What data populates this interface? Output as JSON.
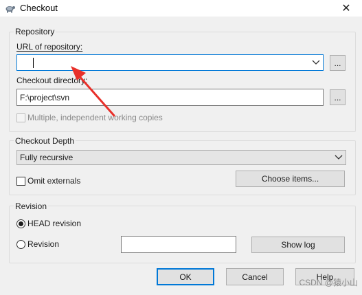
{
  "window": {
    "title": "Checkout",
    "close_glyph": "✕"
  },
  "repository": {
    "group_title": "Repository",
    "url_label": "URL of repository:",
    "url_value": "",
    "browse_label": "...",
    "checkout_dir_label": "Checkout directory:",
    "checkout_dir_value": "F:\\project\\svn",
    "checkout_browse_label": "...",
    "multiple_copies_label": "Multiple, independent working copies",
    "multiple_copies_checked": false,
    "multiple_copies_enabled": false
  },
  "depth": {
    "group_title": "Checkout Depth",
    "selected": "Fully recursive",
    "omit_externals_label": "Omit externals",
    "omit_externals_checked": false,
    "choose_items_label": "Choose items..."
  },
  "revision": {
    "group_title": "Revision",
    "head_label": "HEAD revision",
    "head_checked": true,
    "revision_label": "Revision",
    "revision_checked": false,
    "revision_value": "",
    "show_log_label": "Show log"
  },
  "buttons": {
    "ok": "OK",
    "cancel": "Cancel",
    "help": "Help"
  },
  "annotation": {
    "arrow_color": "#e8302a"
  },
  "watermark": {
    "text": "CSDN @猿小山"
  },
  "icons": {
    "app_icon": "tortoise-icon",
    "dropdown": "chevron-down-icon"
  }
}
